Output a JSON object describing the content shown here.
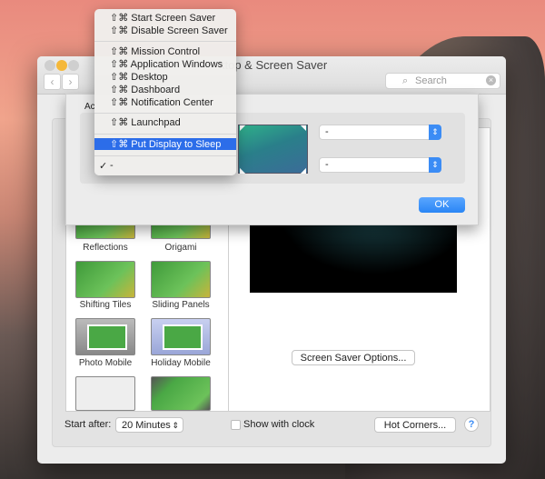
{
  "window": {
    "title": "Desktop & Screen Saver",
    "title_visible": "ktop & Screen Saver",
    "search_placeholder": "Search",
    "back": "‹",
    "forward": "›"
  },
  "sheet": {
    "section_label": "Ac",
    "corner_top_right": "-",
    "corner_bottom_right": "-",
    "ok": "OK"
  },
  "menu": {
    "items": [
      {
        "label": "⇧⌘ Start Screen Saver"
      },
      {
        "label": "⇧⌘ Disable Screen Saver"
      },
      {
        "label": "⇧⌘ Mission Control"
      },
      {
        "label": "⇧⌘ Application Windows"
      },
      {
        "label": "⇧⌘ Desktop"
      },
      {
        "label": "⇧⌘ Dashboard"
      },
      {
        "label": "⇧⌘ Notification Center"
      },
      {
        "label": "⇧⌘ Launchpad"
      },
      {
        "label": "⇧⌘ Put Display to Sleep",
        "highlighted": true
      },
      {
        "label": "-",
        "checked": true
      }
    ]
  },
  "savers": [
    "Reflections",
    "Origami",
    "Shifting Tiles",
    "Sliding Panels",
    "Photo Mobile",
    "Holiday Mobile"
  ],
  "options_button": "Screen Saver Options...",
  "bottom": {
    "start_after_label": "Start after:",
    "start_after_value": "20 Minutes",
    "show_clock": "Show with clock",
    "show_clock_checked": false,
    "hot_corners": "Hot Corners...",
    "help": "?"
  },
  "colors": {
    "accent": "#2c6de9",
    "ok_button": "#3b8cf5"
  }
}
